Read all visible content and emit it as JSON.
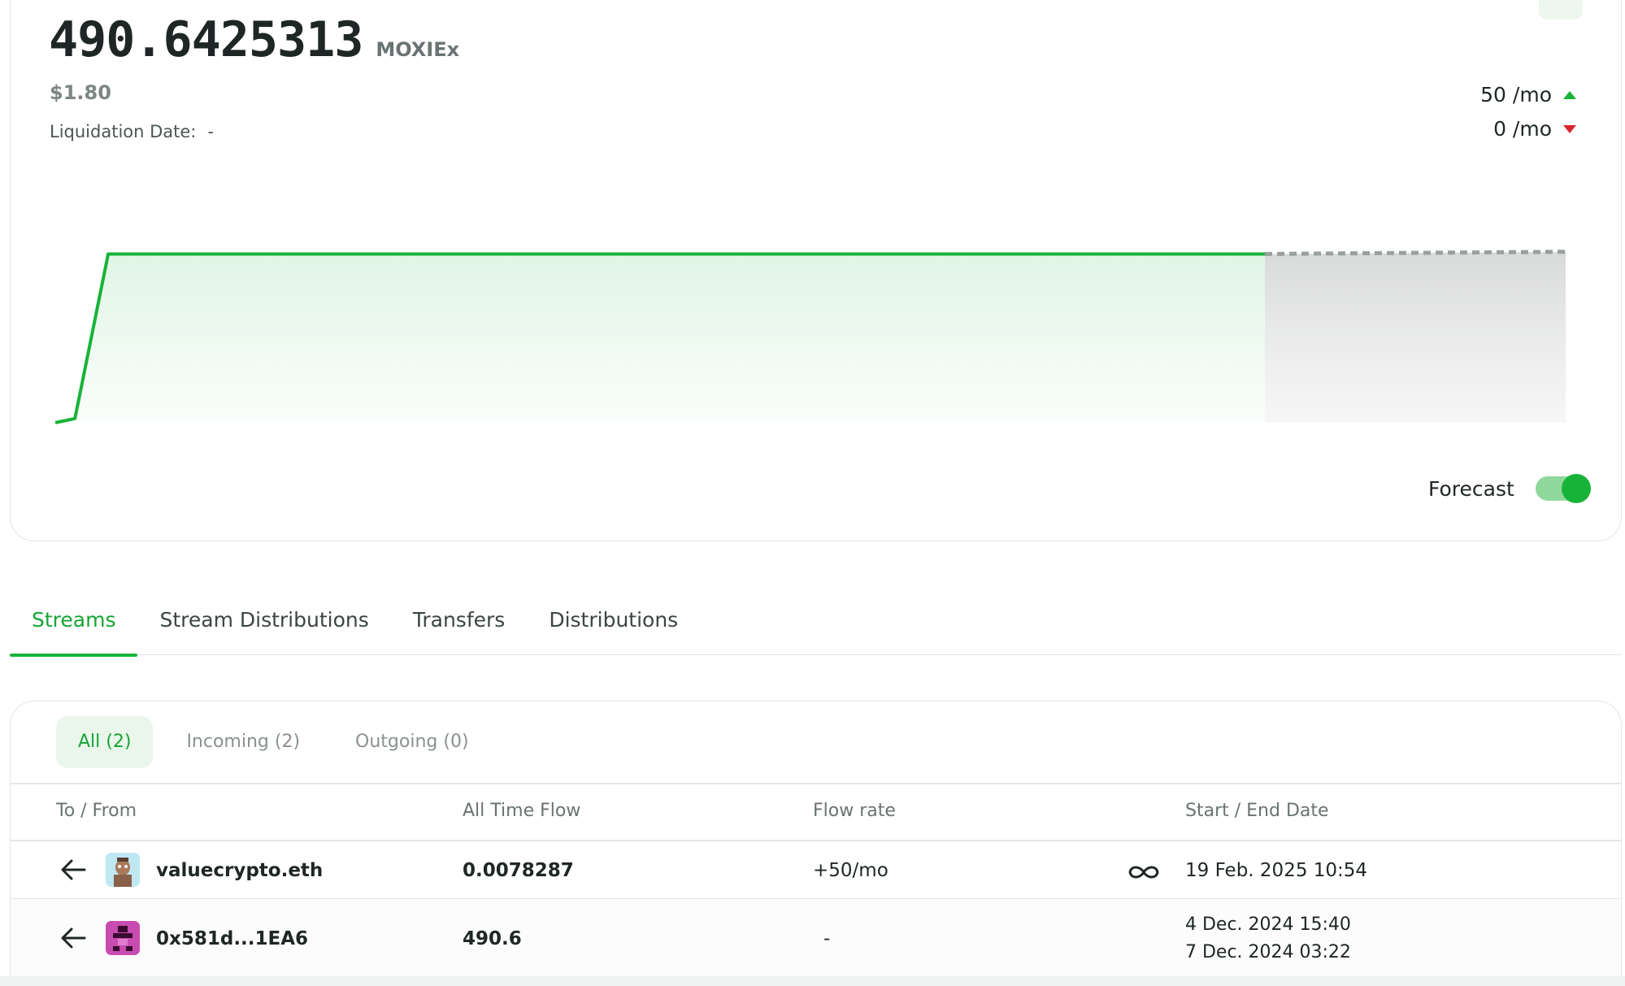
{
  "balance": {
    "amount": "490.6425313",
    "token": "MOXIEx",
    "usd": "$1.80",
    "liquidation_label": "Liquidation Date:",
    "liquidation_value": "-"
  },
  "rates": {
    "incoming": "50 /mo",
    "outgoing": "0 /mo"
  },
  "chart_data": {
    "type": "area",
    "title": "",
    "xlabel": "",
    "ylabel": "",
    "series": [
      {
        "values": [
          0,
          12,
          490.6,
          490.6,
          490.6
        ],
        "x": [
          0,
          0.013,
          0.035,
          0.5,
          0.8
        ]
      }
    ],
    "forecast": {
      "enabled": true,
      "from": 490.6,
      "to": 497
    },
    "colors": {
      "history": "#17b338",
      "forecast": "#9aa0a0"
    },
    "grid": false
  },
  "forecast_toggle": {
    "label": "Forecast",
    "on": true
  },
  "tabs": [
    "Streams",
    "Stream Distributions",
    "Transfers",
    "Distributions"
  ],
  "filters": [
    "All (2)",
    "Incoming (2)",
    "Outgoing (0)"
  ],
  "table": {
    "headers": [
      "To / From",
      "All Time Flow",
      "Flow rate",
      "Start / End Date"
    ],
    "rows": [
      {
        "account": "valuecrypto.eth",
        "flow": "0.0078287",
        "rate": "+50/mo",
        "start": "19 Feb. 2025 10:54",
        "end": ""
      },
      {
        "account": "0x581d...1EA6",
        "flow": "490.6",
        "rate": "-",
        "start": "4 Dec. 2024 15:40",
        "end": "7 Dec. 2024 03:22"
      }
    ]
  },
  "colors": {
    "accent": "#17b338",
    "negative": "#d9262d",
    "muted": "#6a7373"
  }
}
